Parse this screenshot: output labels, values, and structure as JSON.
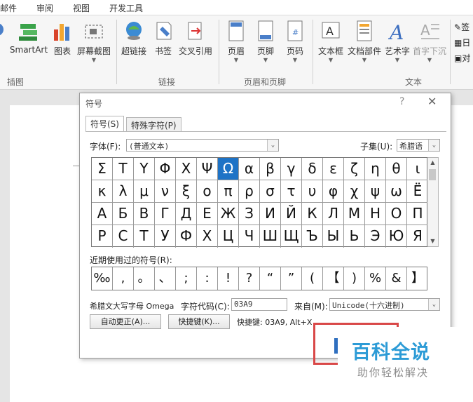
{
  "ribbon": {
    "tabs": [
      "邮件",
      "审阅",
      "视图",
      "开发工具"
    ],
    "buttons": {
      "smartart": "SmartArt",
      "chart": "图表",
      "screenshot": "屏幕截图",
      "hyperlink": "超链接",
      "bookmark": "书签",
      "crossref": "交叉引用",
      "header": "页眉",
      "footer": "页脚",
      "pagenum": "页码",
      "textbox": "文本框",
      "quickparts": "文档部件",
      "wordart": "艺术字",
      "dropcap": "首字下沉",
      "sig": "签",
      "date": "日",
      "obj": "对"
    },
    "groups": {
      "illustrations": "插图",
      "links": "链接",
      "header_footer": "页眉和页脚",
      "text": "文本"
    }
  },
  "dialog": {
    "title": "符号",
    "help": "?",
    "close": "✕",
    "tabs": [
      "符号(S)",
      "特殊字符(P)"
    ],
    "font_label": "字体(F):",
    "font_value": "(普通文本)",
    "subset_label": "子集(U):",
    "subset_value": "希腊语",
    "grid": [
      [
        "Σ",
        "Τ",
        "Υ",
        "Φ",
        "Χ",
        "Ψ",
        "Ω",
        "α",
        "β",
        "γ",
        "δ",
        "ε",
        "ζ",
        "η",
        "θ",
        "ι"
      ],
      [
        "κ",
        "λ",
        "μ",
        "ν",
        "ξ",
        "ο",
        "π",
        "ρ",
        "σ",
        "τ",
        "υ",
        "φ",
        "χ",
        "ψ",
        "ω",
        "Ё"
      ],
      [
        "А",
        "Б",
        "В",
        "Г",
        "Д",
        "Е",
        "Ж",
        "З",
        "И",
        "Й",
        "К",
        "Л",
        "М",
        "Н",
        "О",
        "П"
      ],
      [
        "Р",
        "С",
        "Т",
        "У",
        "Ф",
        "Х",
        "Ц",
        "Ч",
        "Ш",
        "Щ",
        "Ъ",
        "Ы",
        "Ь",
        "Э",
        "Ю",
        "Я"
      ]
    ],
    "selected_symbol": "Ω",
    "recent_label": "近期使用过的符号(R):",
    "recent": [
      "‰",
      ",",
      "。",
      "、",
      ";",
      ":",
      "!",
      "?",
      "“",
      "”",
      "(",
      "【",
      ")",
      "%",
      "&",
      "】"
    ],
    "char_name": "希腊文大写字母 Omega",
    "charcode_label": "字符代码(C):",
    "charcode_value": "03A9",
    "from_label": "来自(M):",
    "from_value": "Unicode(十六进制)",
    "autocorrect_btn": "自动更正(A)...",
    "shortcut_btn": "快捷键(K)...",
    "shortcut_text": "快捷键: 03A9, Alt+X"
  },
  "watermark": {
    "title": "百科全说",
    "subtitle": "助你轻松解决"
  }
}
